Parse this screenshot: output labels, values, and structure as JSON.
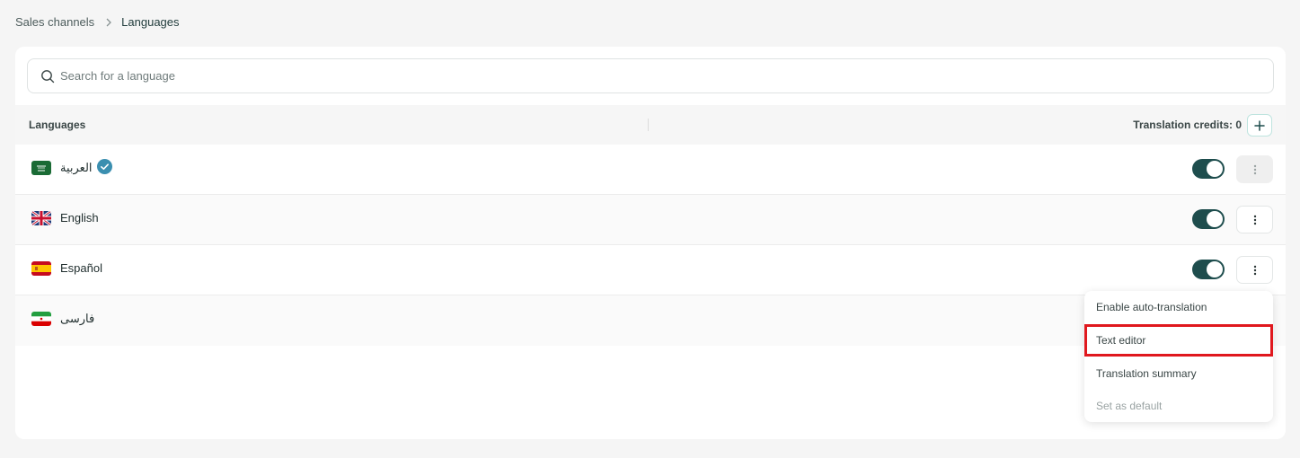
{
  "breadcrumb": {
    "parent": "Sales channels",
    "current": "Languages"
  },
  "search": {
    "placeholder": "Search for a language",
    "value": ""
  },
  "table": {
    "column_languages": "Languages",
    "translation_credits": "Translation credits: 0"
  },
  "languages": [
    {
      "name": "العربية",
      "flag": "saudi-arabia-flag-icon",
      "default": true,
      "enabled": true
    },
    {
      "name": "English",
      "flag": "uk-flag-icon",
      "default": false,
      "enabled": true
    },
    {
      "name": "Español",
      "flag": "spain-flag-icon",
      "default": false,
      "enabled": true
    },
    {
      "name": "فارسی",
      "flag": "iran-flag-icon",
      "default": false,
      "enabled": true
    }
  ],
  "context_menu": {
    "items": [
      "Enable auto-translation",
      "Text editor",
      "Translation summary",
      "Set as default"
    ]
  },
  "colors": {
    "toggle_on": "#1e4d4d",
    "verified_badge": "#3b8fb0",
    "highlight_border": "#e0181e"
  }
}
